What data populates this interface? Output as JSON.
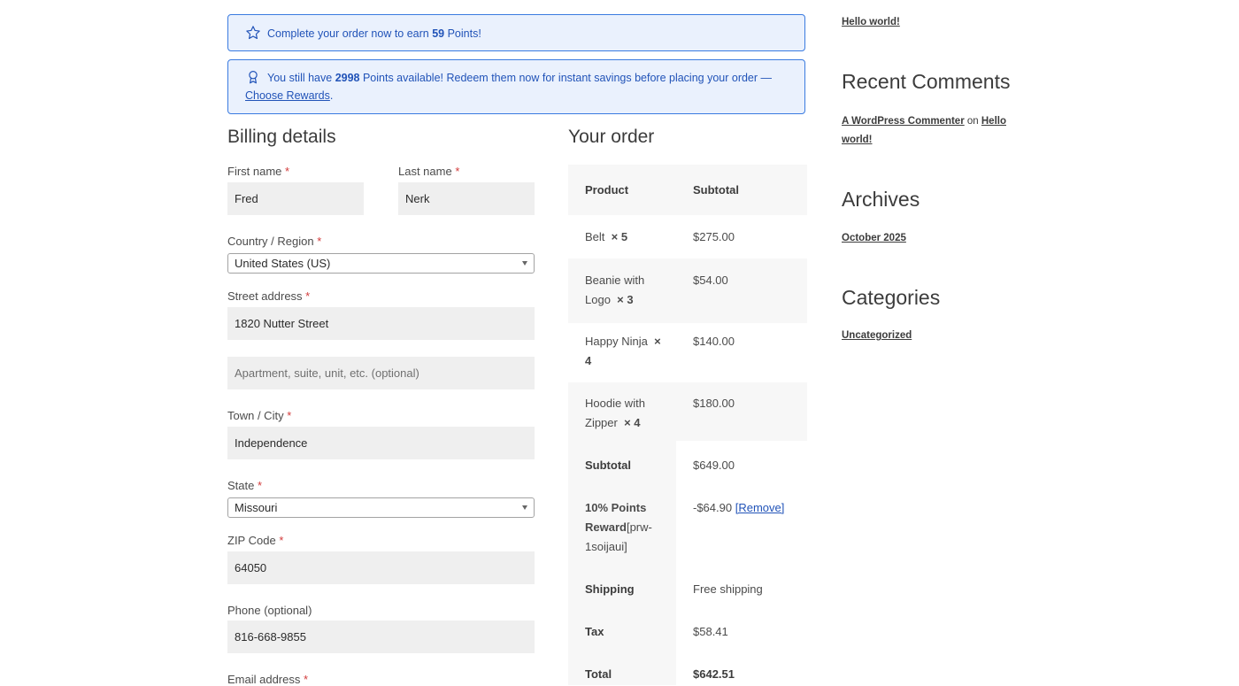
{
  "notices": {
    "earn": {
      "prefix": "Complete your order now to earn ",
      "points": "59",
      "suffix": " Points!"
    },
    "redeem": {
      "prefix": "You still have ",
      "points": "2998",
      "middle": " Points available! Redeem them now for instant savings before placing your order — ",
      "link": "Choose Rewards",
      "suffix": "."
    }
  },
  "billing": {
    "title": "Billing details",
    "required_mark": "*",
    "first_name": {
      "label": "First name",
      "value": "Fred"
    },
    "last_name": {
      "label": "Last name",
      "value": "Nerk"
    },
    "country": {
      "label": "Country / Region",
      "value": "United States (US)"
    },
    "street": {
      "label": "Street address",
      "value": "1820 Nutter Street",
      "placeholder2": "Apartment, suite, unit, etc. (optional)"
    },
    "city": {
      "label": "Town / City",
      "value": "Independence"
    },
    "state": {
      "label": "State",
      "value": "Missouri"
    },
    "zip": {
      "label": "ZIP Code",
      "value": "64050"
    },
    "phone": {
      "label": "Phone (optional)",
      "value": "816-668-9855"
    },
    "email": {
      "label": "Email address"
    }
  },
  "order": {
    "title": "Your order",
    "col_product": "Product",
    "col_subtotal": "Subtotal",
    "items": [
      {
        "name": "Belt",
        "qty": "× 5",
        "price": "$275.00"
      },
      {
        "name": "Beanie with Logo",
        "qty": "× 3",
        "price": "$54.00"
      },
      {
        "name": "Happy Ninja",
        "qty": "× 4",
        "price": "$140.00"
      },
      {
        "name": "Hoodie with Zipper",
        "qty": "× 4",
        "price": "$180.00"
      }
    ],
    "subtotal": {
      "label": "Subtotal",
      "value": "$649.00"
    },
    "reward": {
      "label": "10% Points Reward",
      "code": "[prw-1soijaui]",
      "value": "-$64.90",
      "remove": "[Remove]"
    },
    "shipping": {
      "label": "Shipping",
      "value": "Free shipping"
    },
    "tax": {
      "label": "Tax",
      "value": "$58.41"
    },
    "total": {
      "label": "Total",
      "value": "$642.51"
    }
  },
  "sidebar": {
    "post_link": "Hello world!",
    "recent_comments": {
      "title": "Recent Comments",
      "author": "A WordPress Commenter",
      "on": " on ",
      "post": "Hello world!"
    },
    "archives": {
      "title": "Archives",
      "item": "October 2025"
    },
    "categories": {
      "title": "Categories",
      "item": "Uncategorized"
    }
  },
  "colors": {
    "accent": "#2153b8",
    "notice_bg": "#eaf1fd",
    "required": "#d23b3b"
  }
}
